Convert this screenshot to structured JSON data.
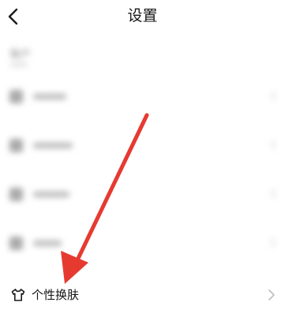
{
  "header": {
    "title": "设置",
    "back_icon": "chevron-left-icon"
  },
  "blurred_section": {
    "title": "账户"
  },
  "skin_item": {
    "label": "个性换肤",
    "icon": "shirt-icon",
    "chevron_icon": "chevron-right-icon"
  },
  "annotation": {
    "arrow_color": "#e63a31",
    "arrow_icon": "red-arrow-annotation"
  }
}
